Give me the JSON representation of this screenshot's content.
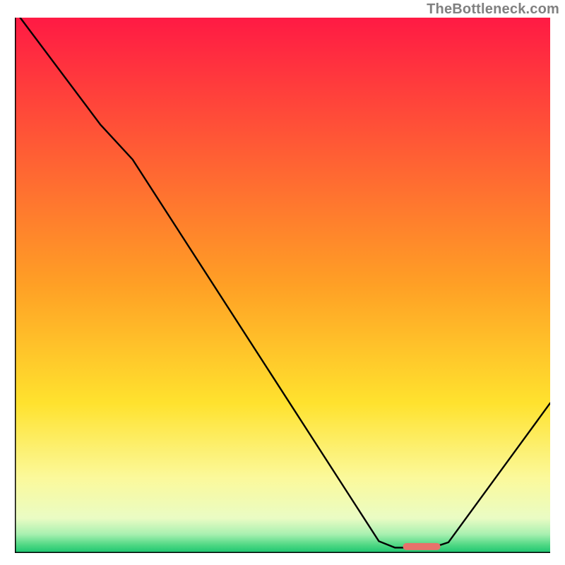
{
  "watermark": "TheBottleneck.com",
  "chart_data": {
    "type": "line",
    "title": "",
    "xlabel": "",
    "ylabel": "",
    "xlim": [
      0,
      100
    ],
    "ylim": [
      0,
      100
    ],
    "gradient_stops": [
      {
        "offset": 0.0,
        "color": "#ff1a44"
      },
      {
        "offset": 0.5,
        "color": "#ffa025"
      },
      {
        "offset": 0.72,
        "color": "#ffe22e"
      },
      {
        "offset": 0.86,
        "color": "#fbf99b"
      },
      {
        "offset": 0.935,
        "color": "#eafcc4"
      },
      {
        "offset": 0.965,
        "color": "#a8f0b0"
      },
      {
        "offset": 0.985,
        "color": "#4fd884"
      },
      {
        "offset": 1.0,
        "color": "#1bc46f"
      }
    ],
    "series": [
      {
        "name": "bottleneck-curve",
        "points": [
          {
            "x": 1.0,
            "y": 100.0
          },
          {
            "x": 16.0,
            "y": 80.0
          },
          {
            "x": 22.0,
            "y": 73.5
          },
          {
            "x": 68.0,
            "y": 2.2
          },
          {
            "x": 71.0,
            "y": 1.0
          },
          {
            "x": 78.0,
            "y": 1.0
          },
          {
            "x": 81.0,
            "y": 2.0
          },
          {
            "x": 100.0,
            "y": 28.0
          }
        ]
      }
    ],
    "marker": {
      "name": "optimal-range",
      "x_start": 72.5,
      "x_end": 79.5,
      "y": 1.2,
      "color": "#e8716b"
    },
    "border_color": "#000000",
    "border_sides": [
      "left",
      "bottom"
    ]
  }
}
